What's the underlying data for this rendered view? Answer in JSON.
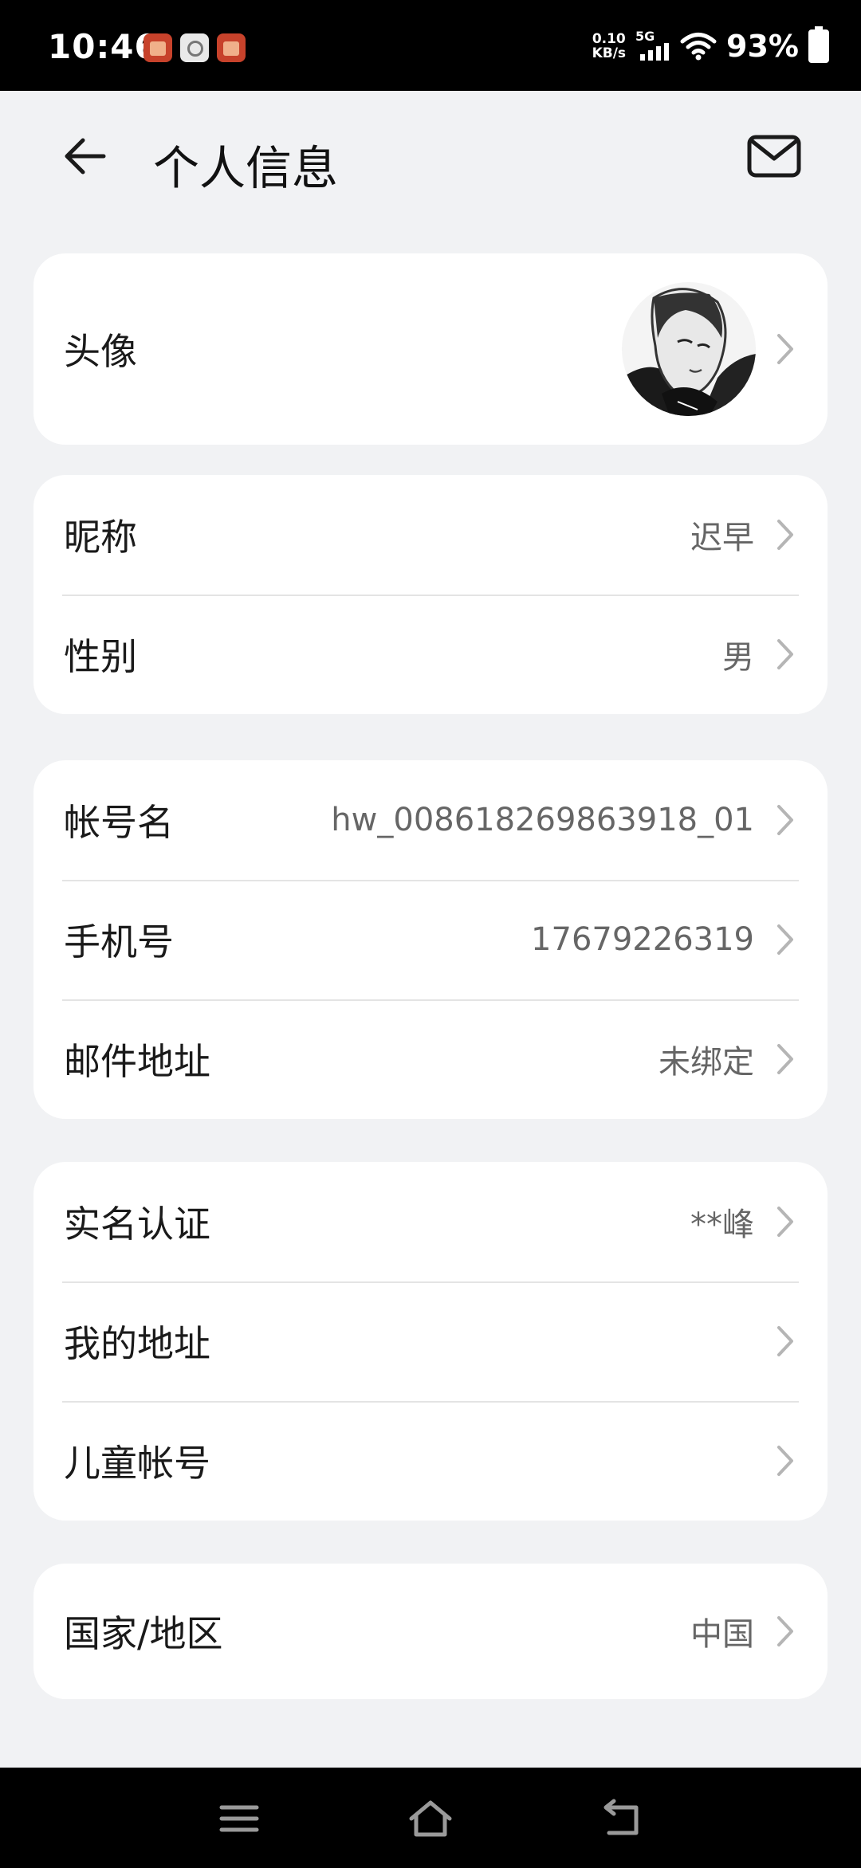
{
  "status_bar": {
    "time": "10:46",
    "net_speed_value": "0.10",
    "net_speed_unit": "KB/s",
    "network": "5G",
    "battery": "93%"
  },
  "header": {
    "title": "个人信息"
  },
  "sections": [
    {
      "rows": [
        {
          "label": "头像",
          "value": ""
        }
      ]
    },
    {
      "rows": [
        {
          "label": "昵称",
          "value": "迟早"
        },
        {
          "label": "性别",
          "value": "男"
        }
      ]
    },
    {
      "rows": [
        {
          "label": "帐号名",
          "value": "hw_008618269863918_01"
        },
        {
          "label": "手机号",
          "value": "17679226319"
        },
        {
          "label": "邮件地址",
          "value": "未绑定"
        }
      ]
    },
    {
      "rows": [
        {
          "label": "实名认证",
          "value": "**峰"
        },
        {
          "label": "我的地址",
          "value": ""
        },
        {
          "label": "儿童帐号",
          "value": ""
        }
      ]
    },
    {
      "rows": [
        {
          "label": "国家/地区",
          "value": "中国"
        }
      ]
    }
  ],
  "icons": {
    "back": "arrow-left-icon",
    "mail": "envelope-icon",
    "chevron": "chevron-right-icon"
  }
}
